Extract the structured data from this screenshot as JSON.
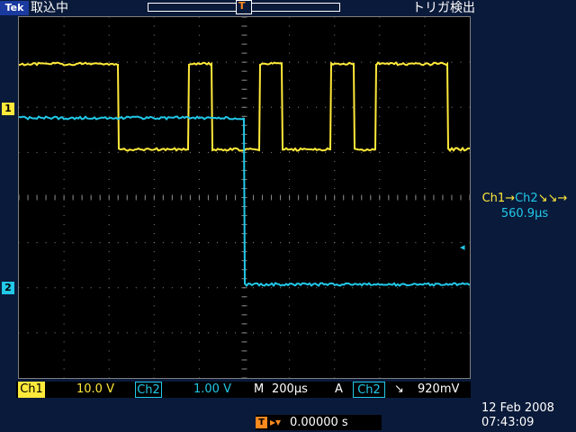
{
  "top": {
    "logo": "Tek",
    "acq_status": "取込中",
    "trig_status": "トリガ検出",
    "trig_position_symbol": "T"
  },
  "markers": {
    "ch1": "1",
    "ch2": "2",
    "trigger": "T"
  },
  "measurement": {
    "source": "Ch1",
    "arrow": "→",
    "target": "Ch2",
    "edge_symbol": "↘↘→",
    "value": "560.9µs"
  },
  "bottom": {
    "ch1_label": "Ch1",
    "ch1_scale": "10.0 V",
    "ch2_label": "Ch2",
    "ch2_scale": "1.00 V",
    "timebase_prefix": "M",
    "timebase": "200µs",
    "trigger_prefix": "A",
    "trigger_source": "Ch2",
    "trigger_slope": "↘",
    "trigger_level": "920mV"
  },
  "position": {
    "icon": "T",
    "arrow": "▸▾",
    "value": "0.00000 s"
  },
  "datetime": {
    "date": "12 Feb  2008",
    "time": "07:43:09"
  },
  "colors": {
    "ch1": "#ffe93a",
    "ch2": "#22c8e8",
    "trigger": "#ff8a1e",
    "background": "#0a1a3a"
  },
  "icons": {
    "trigger_marker": "trigger-icon",
    "ch1_marker": "ch1-marker-icon",
    "ch2_marker": "ch2-marker-icon"
  }
}
